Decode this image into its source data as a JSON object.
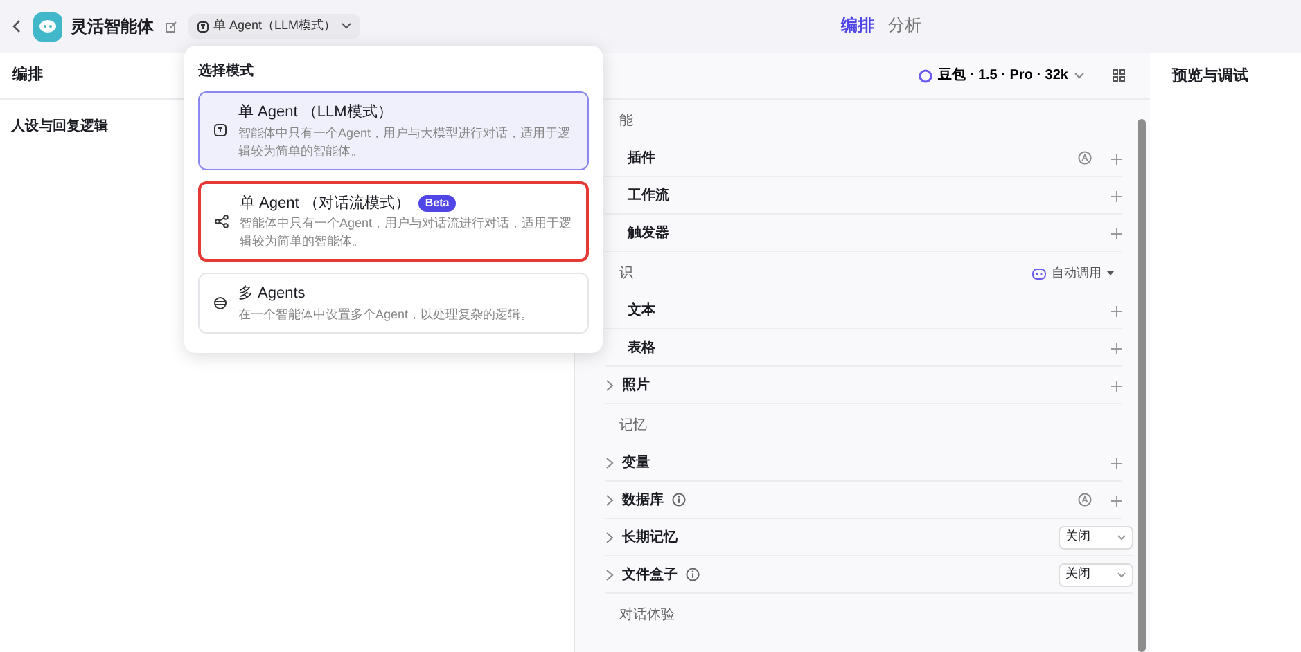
{
  "topbar": {
    "app_name": "灵活智能体",
    "mode_button": "单 Agent（LLM模式）",
    "tabs": [
      {
        "label": "编排",
        "selected": true
      },
      {
        "label": "分析",
        "selected": false
      }
    ]
  },
  "left_panel": {
    "title": "编排",
    "section": "人设与回复逻辑"
  },
  "middle_panel": {
    "model": "豆包 · 1.5 · Pro · 32k",
    "groups": [
      {
        "title": "能",
        "rows": [
          {
            "label": "插件",
            "kind": "auto-add",
            "chevron": false,
            "info": false
          },
          {
            "label": "工作流",
            "kind": "add",
            "chevron": false,
            "info": false
          },
          {
            "label": "触发器",
            "kind": "add",
            "chevron": false,
            "info": false
          }
        ]
      },
      {
        "title": "识",
        "action": "自动调用",
        "rows": [
          {
            "label": "文本",
            "kind": "add",
            "chevron": false,
            "info": false
          },
          {
            "label": "表格",
            "kind": "add",
            "chevron": false,
            "info": false
          },
          {
            "label": "照片",
            "kind": "add",
            "chevron": true,
            "info": false
          }
        ]
      },
      {
        "title": "记忆",
        "rows": [
          {
            "label": "变量",
            "kind": "add",
            "chevron": true,
            "info": false
          },
          {
            "label": "数据库",
            "kind": "auto-add",
            "chevron": true,
            "info": true
          },
          {
            "label": "长期记忆",
            "kind": "select",
            "value": "关闭",
            "chevron": true,
            "info": false
          },
          {
            "label": "文件盒子",
            "kind": "select",
            "value": "关闭",
            "chevron": true,
            "info": true
          }
        ]
      },
      {
        "title": "对话体验"
      }
    ]
  },
  "right_panel": {
    "title": "预览与调试"
  },
  "mode_menu": {
    "title": "选择模式",
    "options": [
      {
        "kind": "llm",
        "title": "单 Agent （LLM模式）",
        "description": "智能体中只有一个Agent，用户与大模型进行对话，适用于逻辑较为简单的智能体。",
        "selected": true,
        "highlighted": false
      },
      {
        "kind": "flow",
        "title": "单 Agent （对话流模式）",
        "badge": "Beta",
        "description": "智能体中只有一个Agent，用户与对话流进行对话，适用于逻辑较为简单的智能体。",
        "selected": false,
        "highlighted": true
      },
      {
        "kind": "multi",
        "title": "多 Agents",
        "description": "在一个智能体中设置多个Agent，以处理复杂的逻辑。",
        "selected": false,
        "highlighted": false
      }
    ]
  }
}
